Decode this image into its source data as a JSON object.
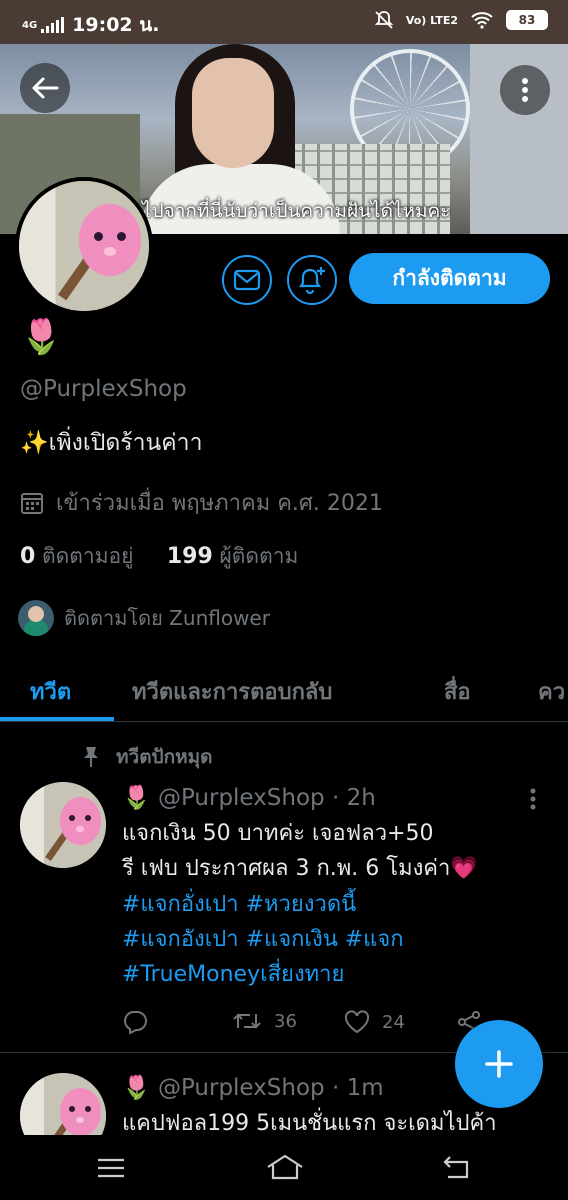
{
  "status_bar": {
    "network": "4G",
    "time": "19:02 น.",
    "lte": "Vo) LTE2",
    "battery": "83"
  },
  "banner": {
    "subtitle": "ไปจากที่นี่นับว่าเป็นความฝันได้ไหมคะ"
  },
  "profile": {
    "name": "🌷",
    "handle": "@PurplexShop",
    "bio": "✨เพิ่งเปิดร้านค่าา",
    "joined": "เข้าร่วมเมื่อ พฤษภาคม ค.ศ. 2021",
    "following_count": "0",
    "following_label": "ติดตามอยู่",
    "followers_count": "199",
    "followers_label": "ผู้ติดตาม",
    "followed_by": "ติดตามโดย Zunflower",
    "follow_button": "กำลังติดตาม"
  },
  "tabs": [
    "ทวีต",
    "ทวีตและการตอบกลับ",
    "สื่อ",
    "คว"
  ],
  "pinned_label": "ทวีตปักหมุด",
  "tweets": [
    {
      "header": "🌷 @PurplexShop · 2h",
      "lines": [
        "แจกเงิน 50 บาทค่ะ เจอฟลว+50",
        "รี เฟบ ประกาศผล 3 ก.พ. 6 โมงค่า💗"
      ],
      "tags": [
        "#แจกอั่งเปา #หวยงวดนี้",
        "#แจกอังเปา #แจกเงิน #แจก",
        "#TrueMoneyเสี่ยงทาย"
      ],
      "retweets": "36",
      "likes": "24"
    },
    {
      "header": "🌷 @PurplexShop · 1m",
      "lines": [
        "แคปฟอล199 5เมนชั่นแรก จะเดมไปค้า"
      ]
    }
  ],
  "colors": {
    "accent": "#1d9bf0",
    "background": "#000000",
    "muted": "#71767b",
    "status_bar": "#4a3b35"
  }
}
